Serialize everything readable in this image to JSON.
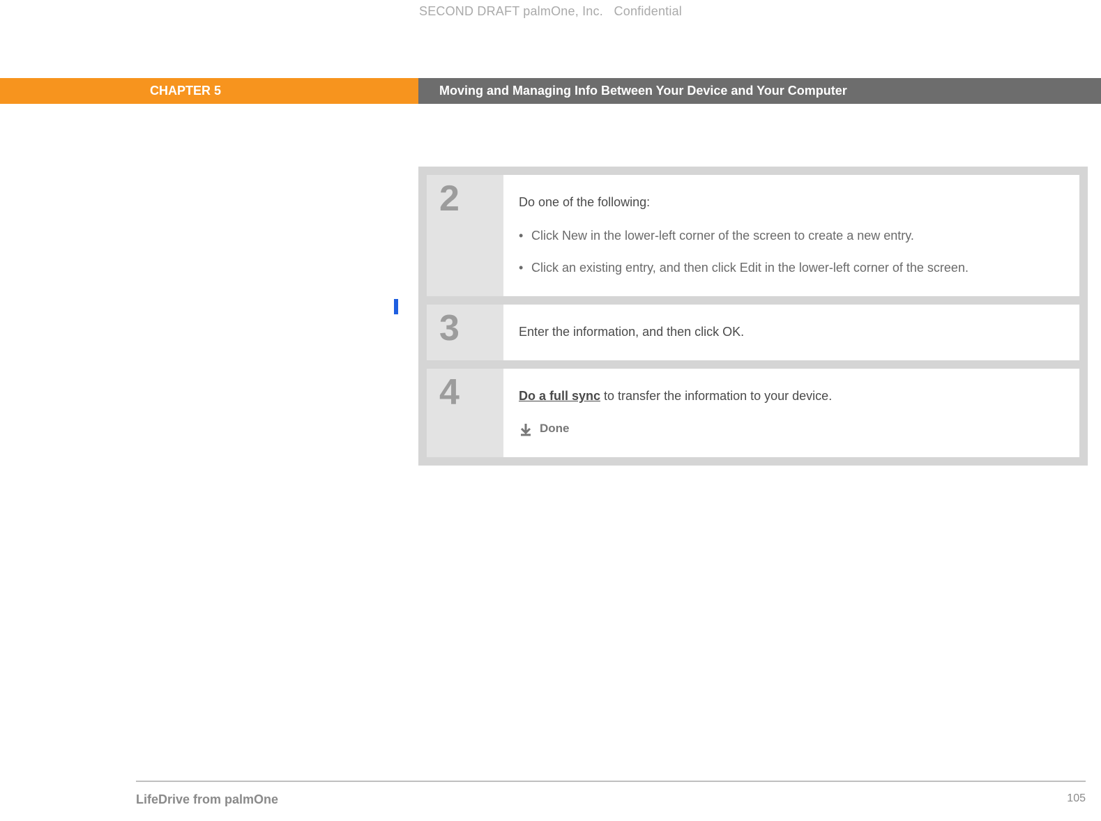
{
  "draft_header": {
    "left": "SECOND DRAFT palmOne, Inc.",
    "right": "Confidential"
  },
  "chapter": {
    "label": "CHAPTER 5",
    "title": "Moving and Managing Info Between Your Device and Your Computer"
  },
  "steps": [
    {
      "num": "2",
      "lead": "Do one of the following:",
      "bullets": [
        "Click New in the lower-left corner of the screen to create a new entry.",
        "Click an existing entry, and then click Edit in the lower-left corner of the screen."
      ]
    },
    {
      "num": "3",
      "text": "Enter the information, and then click OK."
    },
    {
      "num": "4",
      "link_text": "Do a full sync",
      "tail_text": " to transfer the information to your device.",
      "done_label": "Done"
    }
  ],
  "footer": {
    "product": "LifeDrive from palmOne",
    "page": "105"
  }
}
